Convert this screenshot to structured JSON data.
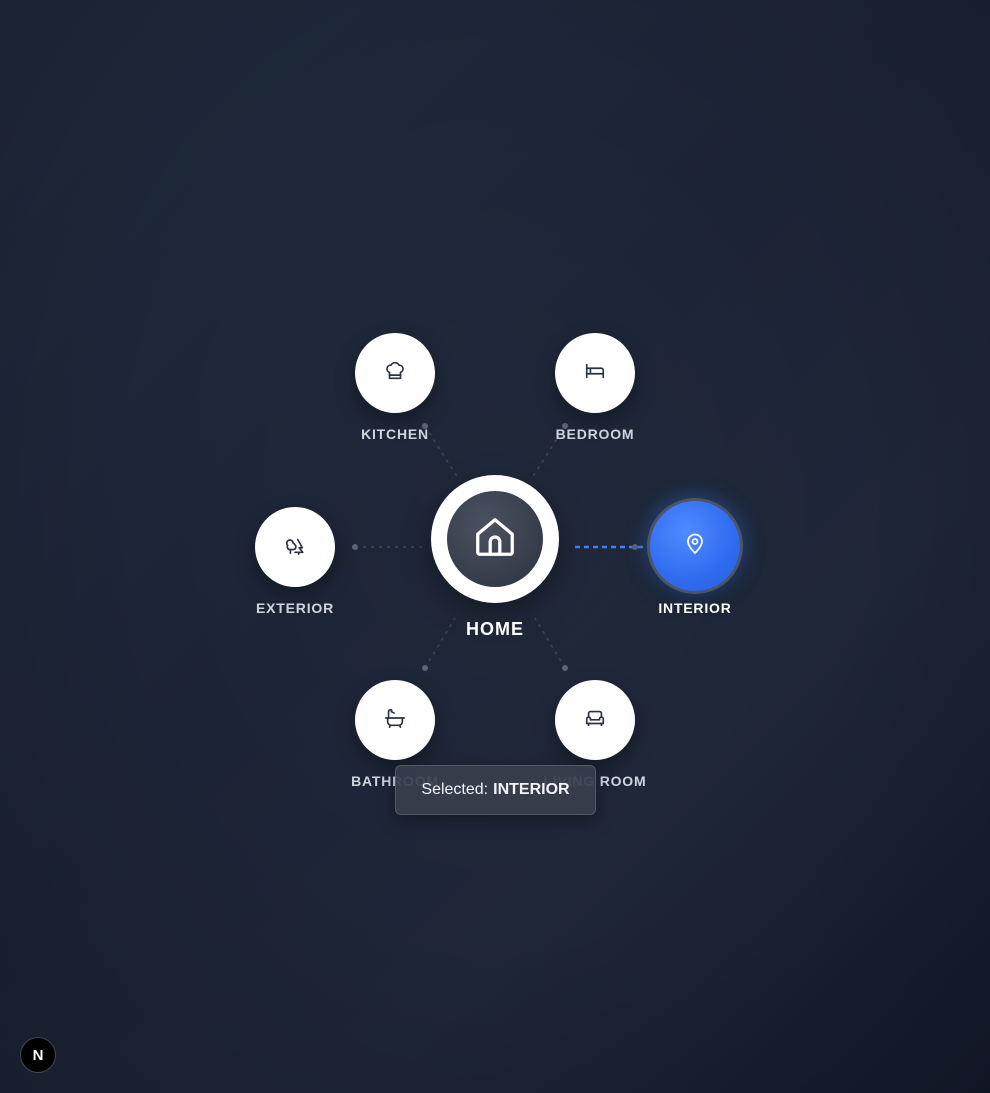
{
  "hub": {
    "label": "HOME",
    "icon": "home-icon"
  },
  "nodes": {
    "kitchen": {
      "label": "KITCHEN",
      "icon": "chef-hat-icon"
    },
    "bedroom": {
      "label": "BEDROOM",
      "icon": "bed-icon"
    },
    "exterior": {
      "label": "EXTERIOR",
      "icon": "trees-icon"
    },
    "interior": {
      "label": "INTERIOR",
      "icon": "map-pin-icon",
      "selected": true
    },
    "bathroom": {
      "label": "BATHROOM",
      "icon": "bath-icon"
    },
    "living_room": {
      "label": "LIVING ROOM",
      "icon": "sofa-icon"
    }
  },
  "status": {
    "prefix": "Selected:",
    "value": "INTERIOR"
  },
  "badge": {
    "letter": "N"
  },
  "colors": {
    "accent": "#3b82f6",
    "node_bg": "#ffffff",
    "hub_inner": "#3a414d",
    "label": "#cfd5df"
  }
}
